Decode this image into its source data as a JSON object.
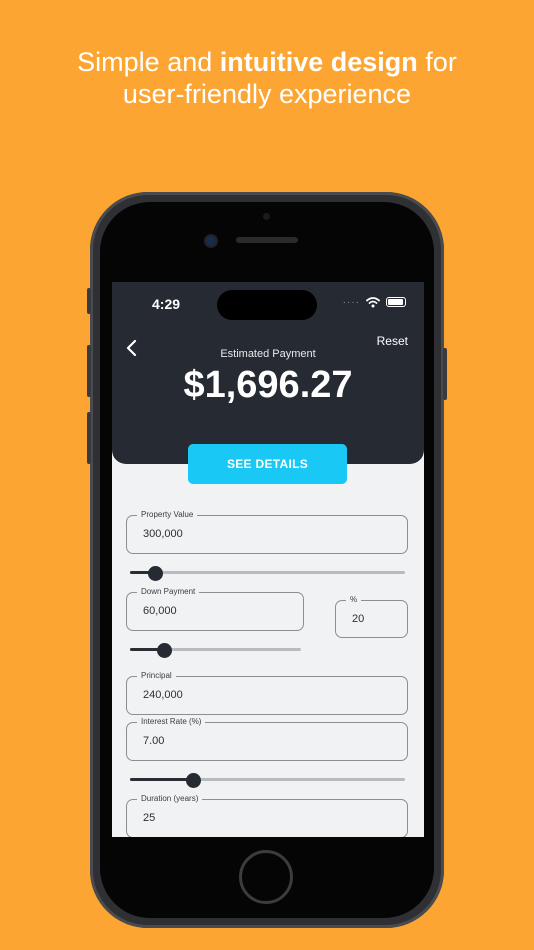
{
  "promo": {
    "line1_normal": "Simple and ",
    "line1_bold": "intuitive design",
    "line1_end": " for",
    "line2": "user-friendly experience"
  },
  "status_bar": {
    "time": "4:29",
    "signal_dots": "····"
  },
  "header": {
    "reset_label": "Reset",
    "estimated_label": "Estimated Payment",
    "amount": "$1,696.27"
  },
  "see_details_label": "SEE DETAILS",
  "fields": {
    "property_value": {
      "label": "Property Value",
      "value": "300,000"
    },
    "down_payment": {
      "label": "Down Payment",
      "value": "60,000"
    },
    "down_percent": {
      "label": "%",
      "value": "20"
    },
    "principal": {
      "label": "Principal",
      "value": "240,000"
    },
    "interest_rate": {
      "label": "Interest Rate (%)",
      "value": "7.00"
    },
    "duration": {
      "label": "Duration (years)",
      "value": "25"
    }
  },
  "sliders": {
    "property_value": 0.09,
    "down_payment": 0.2,
    "interest_rate": 0.23
  },
  "colors": {
    "background": "#FCA532",
    "header": "#262A33",
    "accent": "#19C8F5"
  }
}
